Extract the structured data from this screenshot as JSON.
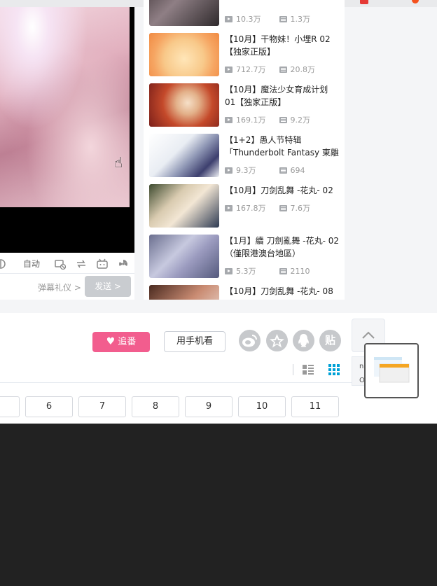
{
  "player": {
    "auto_label": "自动",
    "etiquette_link": "弹幕礼仪 >",
    "send_button": "发送 >"
  },
  "recommend": [
    {
      "title": "",
      "plays": "10.3万",
      "danmaku": "1.3万"
    },
    {
      "title": "【10月】干物妹！小埋R 02【独家正版】",
      "plays": "712.7万",
      "danmaku": "20.8万"
    },
    {
      "title": "【10月】魔法少女育成计划 01【独家正版】",
      "plays": "169.1万",
      "danmaku": "9.2万"
    },
    {
      "title": "【1+2】愚人节特辑「Thunderbolt Fantasy 東離劍",
      "plays": "9.3万",
      "danmaku": "694"
    },
    {
      "title": "【10月】刀剑乱舞 -花丸- 02",
      "plays": "167.8万",
      "danmaku": "7.6万"
    },
    {
      "title": "【1月】續 刀劍亂舞 -花丸- 02（僅限港澳台地區）",
      "plays": "5.3万",
      "danmaku": "2110"
    },
    {
      "title": "【10月】刀剑乱舞 -花丸- 08",
      "plays": "",
      "danmaku": ""
    }
  ],
  "actions": {
    "follow_button": "追番",
    "mobile_button": "用手机看",
    "share_icons": [
      "weibo-icon",
      "qzone-icon",
      "qq-icon",
      "tieba-icon"
    ],
    "tieba_label": "贴",
    "side_letters": "n\nO"
  },
  "pagination": [
    "6",
    "7",
    "8",
    "9",
    "10",
    "11"
  ],
  "colors": {
    "accent": "#f25d8e",
    "footer": "#222222",
    "panel_bg": "#f4f5f7"
  }
}
